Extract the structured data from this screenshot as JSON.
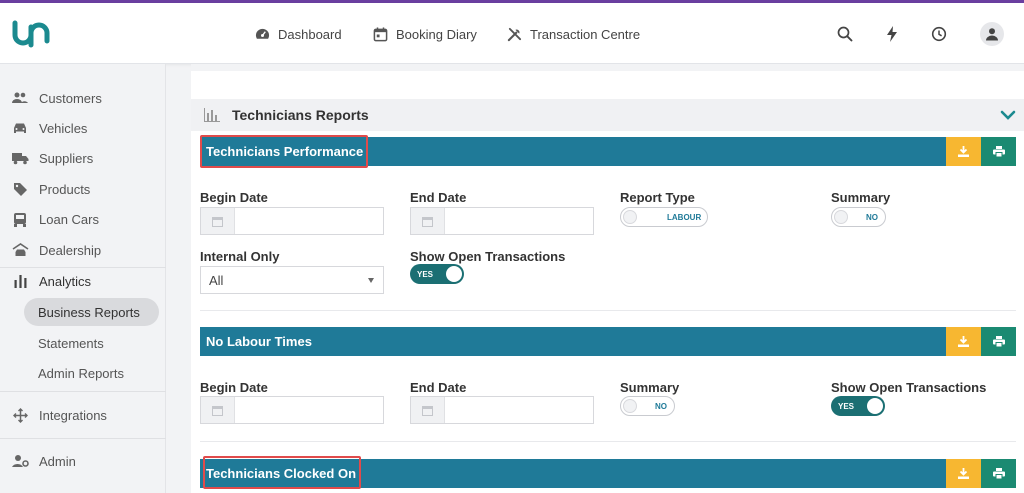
{
  "topnav": {
    "dashboard": "Dashboard",
    "booking_diary": "Booking Diary",
    "transaction_centre": "Transaction Centre"
  },
  "sidebar": {
    "customers": "Customers",
    "vehicles": "Vehicles",
    "suppliers": "Suppliers",
    "products": "Products",
    "loan_cars": "Loan Cars",
    "dealership": "Dealership",
    "analytics": "Analytics",
    "business_reports": "Business Reports",
    "statements": "Statements",
    "admin_reports": "Admin Reports",
    "integrations": "Integrations",
    "admin": "Admin"
  },
  "section": {
    "title": "Technicians Reports"
  },
  "reports": [
    {
      "title": "Technicians Performance",
      "begin_date_label": "Begin Date",
      "end_date_label": "End Date",
      "report_type_label": "Report Type",
      "report_type_value": "LABOUR",
      "summary_label": "Summary",
      "summary_value": "NO",
      "internal_only_label": "Internal Only",
      "internal_only_value": "All",
      "show_open_label": "Show Open Transactions",
      "show_open_value": "YES"
    },
    {
      "title": "No Labour Times",
      "begin_date_label": "Begin Date",
      "end_date_label": "End Date",
      "summary_label": "Summary",
      "summary_value": "NO",
      "show_open_label": "Show Open Transactions",
      "show_open_value": "YES"
    },
    {
      "title": "Technicians Clocked On"
    }
  ],
  "colors": {
    "brand": "#1b8a8f",
    "report_bar": "#1f7a98",
    "download_button": "#f7b731",
    "print_button": "#1b8a72",
    "highlight": "#e04b4b",
    "toggle_on": "#1b6f73"
  },
  "icons": {
    "download": "download-icon",
    "print": "print-icon",
    "calendar": "calendar-icon",
    "chevron": "chevron-down-icon"
  }
}
